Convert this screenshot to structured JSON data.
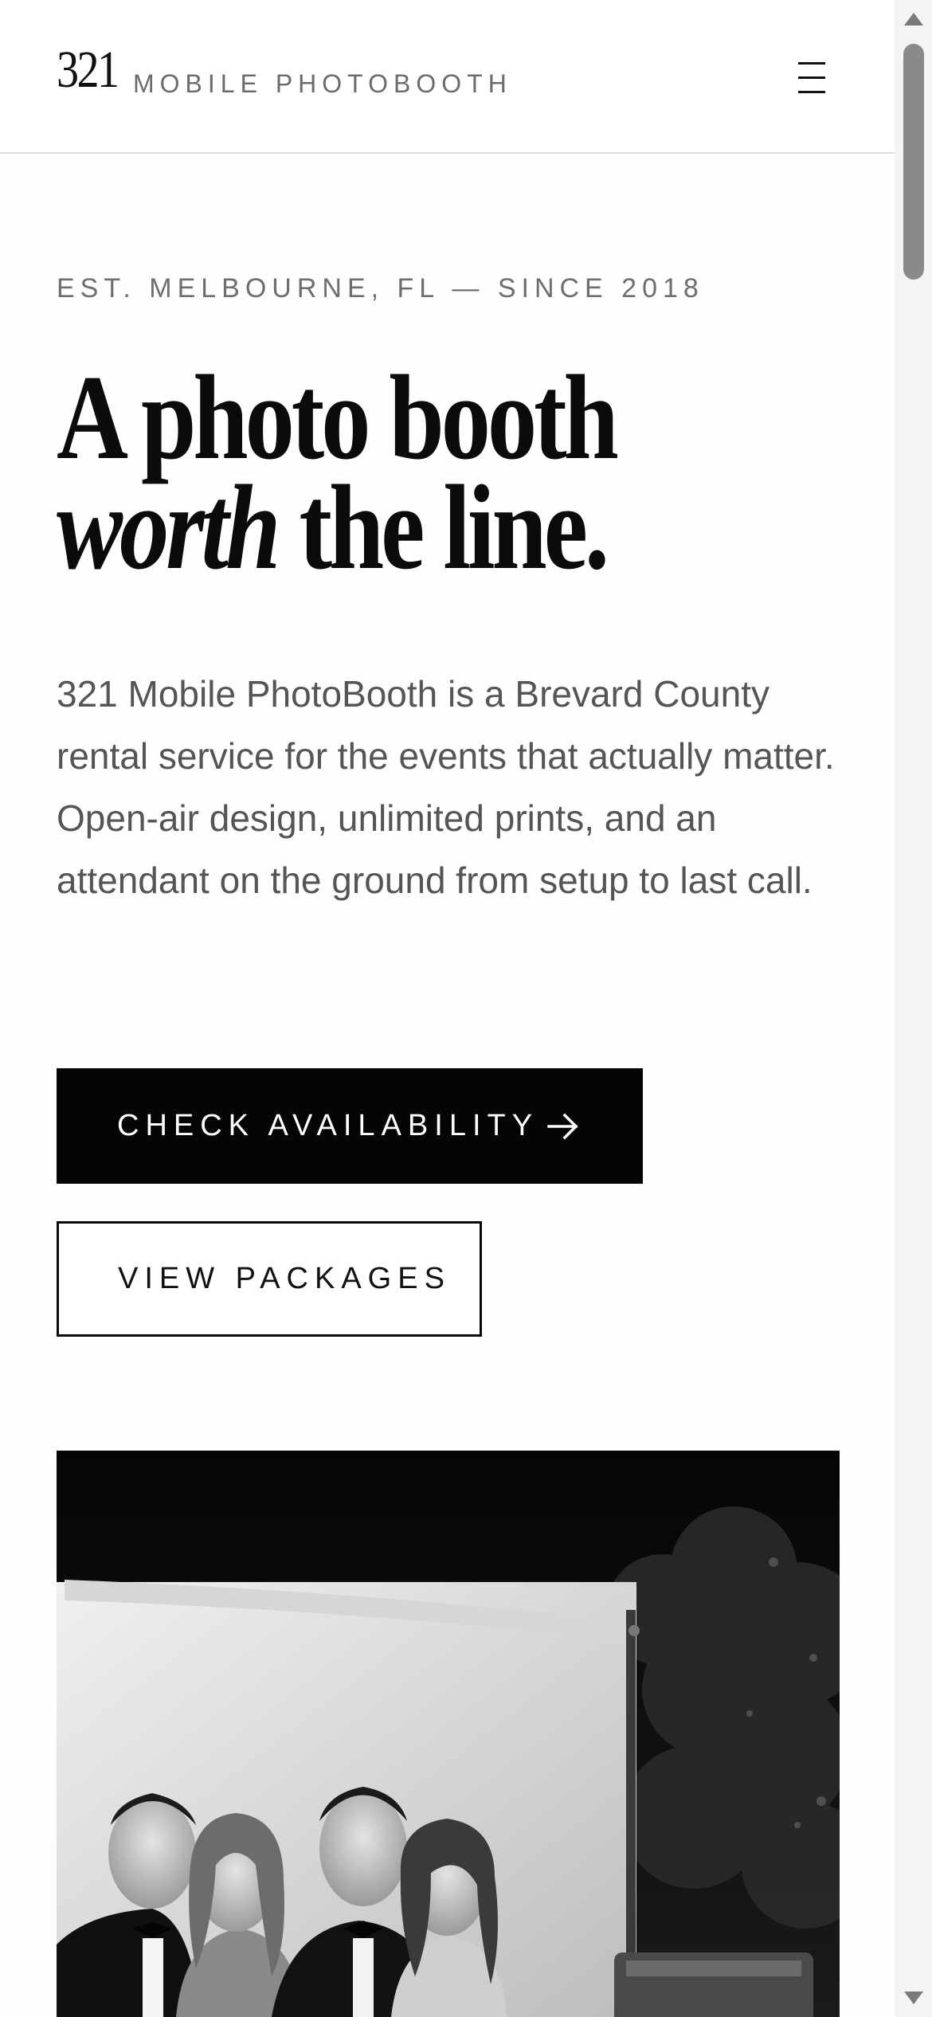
{
  "header": {
    "logo_number": "321",
    "logo_text": "MOBILE PHOTOBOOTH",
    "menu_icon": "hamburger-menu-icon"
  },
  "hero": {
    "eyebrow": "EST. MELBOURNE, FL — SINCE 2018",
    "headline_line1": "A photo booth",
    "headline_italic": "worth",
    "headline_line2_rest": " the line.",
    "body": "321 Mobile PhotoBooth is a Brevard County rental service for the events that actually matter. Open-air design, unlimited prints, and an attendant on the ground from setup to last call.",
    "primary_button": {
      "label": "CHECK AVAILABILITY",
      "icon": "arrow-right-icon"
    },
    "secondary_button": {
      "label": "VIEW PACKAGES"
    },
    "photo": {
      "description_icon": "photo-booth-guests-image"
    }
  },
  "colors": {
    "text": "#0a0a0a",
    "muted": "#6e6e6e",
    "body": "#555555",
    "primary_bg": "#050505",
    "primary_fg": "#ffffff",
    "divider": "#dcdcdc"
  }
}
